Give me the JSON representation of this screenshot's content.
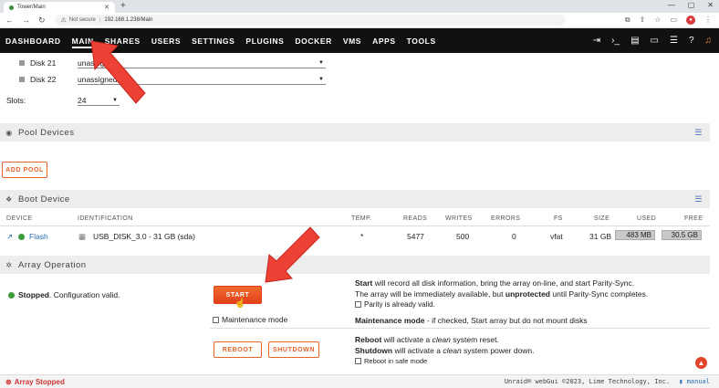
{
  "browser": {
    "tab_title": "Tower/Main",
    "security": "Not secure",
    "url": "192.168.1.238/Main"
  },
  "nav": {
    "items": [
      "DASHBOARD",
      "MAIN",
      "SHARES",
      "USERS",
      "SETTINGS",
      "PLUGINS",
      "DOCKER",
      "VMS",
      "APPS",
      "TOOLS"
    ],
    "active": "MAIN"
  },
  "disks": [
    {
      "name": "Disk 21",
      "value": "unassigned"
    },
    {
      "name": "Disk 22",
      "value": "unassigned"
    }
  ],
  "slots": {
    "label": "Slots:",
    "value": "24"
  },
  "pool": {
    "header": "Pool Devices",
    "add_button": "ADD POOL"
  },
  "boot": {
    "header": "Boot Device",
    "columns": [
      "DEVICE",
      "IDENTIFICATION",
      "TEMP.",
      "READS",
      "WRITES",
      "ERRORS",
      "FS",
      "SIZE",
      "USED",
      "FREE"
    ],
    "row": {
      "device": "Flash",
      "identification": "USB_DISK_3.0 - 31 GB (sda)",
      "temp": "*",
      "reads": "5477",
      "writes": "500",
      "errors": "0",
      "fs": "vfat",
      "size": "31 GB",
      "used": "483 MB",
      "free": "30.5 GB"
    }
  },
  "array": {
    "header": "Array Operation",
    "status_bold": "Stopped",
    "status_rest": ". Configuration valid.",
    "start_button": "START",
    "maintenance_label": "Maintenance mode",
    "start_desc_bold": "Start",
    "start_desc": " will record all disk information, bring the array on-line, and start Parity-Sync.",
    "avail_desc_1": "The array will be immediately available, but ",
    "avail_desc_bold": "unprotected",
    "avail_desc_2": " until Parity-Sync completes.",
    "parity_valid": "Parity is already valid.",
    "maint_desc_bold": "Maintenance mode",
    "maint_desc": " - if checked, Start array but do not mount disks",
    "reboot_button": "REBOOT",
    "shutdown_button": "SHUTDOWN",
    "reboot_desc_bold": "Reboot",
    "reboot_desc_1": " will activate a ",
    "reboot_desc_em": "clean",
    "reboot_desc_2": " system reset.",
    "shutdown_desc_bold": "Shutdown",
    "shutdown_desc_1": " will activate a ",
    "shutdown_desc_em": "clean",
    "shutdown_desc_2": " system power down.",
    "safe_mode": "Reboot in safe mode"
  },
  "footer": {
    "status": "Array Stopped",
    "copyright": "Unraid® webGui ©2023, Lime Technology, Inc.",
    "manual": "manual"
  },
  "colors": {
    "accent": "#e2652b",
    "nav_bg": "#111111",
    "stopped": "#d03434",
    "ok": "#3a9d3a",
    "arrow": "#ee4136"
  }
}
